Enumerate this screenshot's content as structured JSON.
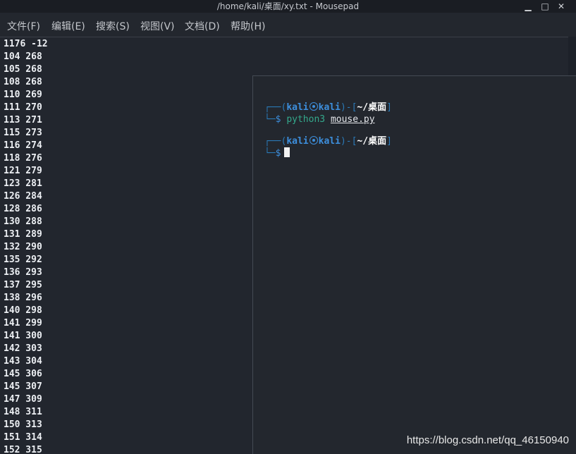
{
  "window": {
    "title": "/home/kali/桌面/xy.txt - Mousepad",
    "controls": {
      "minimize": "▁",
      "maximize": "□",
      "close": "✕"
    }
  },
  "menubar": {
    "items": [
      "文件(F)",
      "编辑(E)",
      "搜索(S)",
      "视图(V)",
      "文档(D)",
      "帮助(H)"
    ]
  },
  "editor": {
    "lines": [
      "1176 -12",
      "104 268",
      "105 268",
      "108 268",
      "110 269",
      "111 270",
      "113 271",
      "115 273",
      "116 274",
      "118 276",
      "121 279",
      "123 281",
      "126 284",
      "128 286",
      "130 288",
      "131 289",
      "132 290",
      "135 292",
      "136 293",
      "137 295",
      "138 296",
      "140 298",
      "141 299",
      "141 300",
      "142 303",
      "143 304",
      "145 306",
      "145 307",
      "147 309",
      "148 311",
      "150 313",
      "151 314",
      "152 315"
    ]
  },
  "terminal": {
    "prompts": [
      {
        "corner_top": "┌──(",
        "user": "kali",
        "host": "kali",
        "mid": ")-[",
        "path": "~/桌面",
        "end": "]",
        "corner_bottom": "└─",
        "dollar": "$",
        "command": "python3",
        "argument": "mouse.py"
      },
      {
        "corner_top": "┌──(",
        "user": "kali",
        "host": "kali",
        "mid": ")-[",
        "path": "~/桌面",
        "end": "]",
        "corner_bottom": "└─",
        "dollar": "$"
      }
    ]
  },
  "watermark": "https://blog.csdn.net/qq_46150940"
}
